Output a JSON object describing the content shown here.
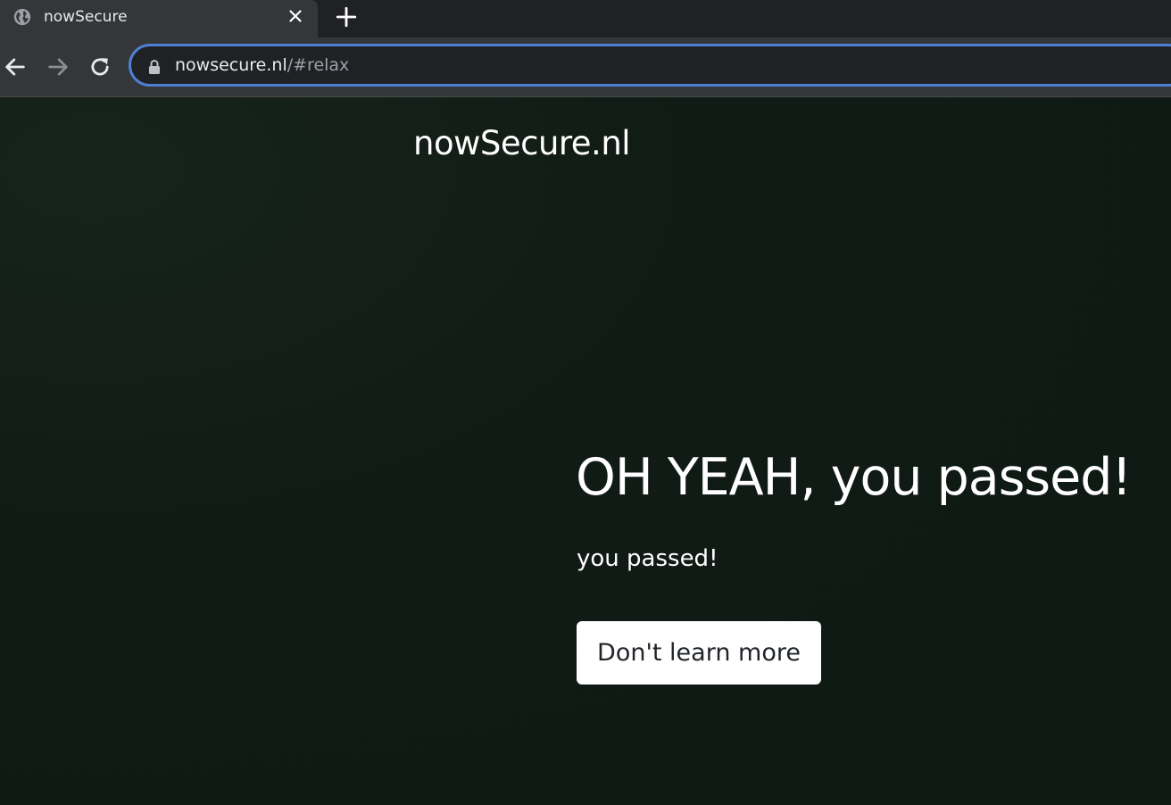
{
  "browser": {
    "tab": {
      "title": "nowSecure",
      "favicon": "globe-icon",
      "close_icon": "close-icon"
    },
    "new_tab_icon": "plus-icon",
    "nav": {
      "back_icon": "arrow-left-icon",
      "forward_icon": "arrow-right-icon",
      "reload_icon": "reload-icon"
    },
    "omnibox": {
      "lock_icon": "lock-icon",
      "host": "nowsecure.nl",
      "path": "/#relax",
      "focus_color": "#4f7fd4"
    }
  },
  "page": {
    "site_title": "nowSecure.nl",
    "headline": "OH YEAH, you passed!",
    "subtext": "you passed!",
    "button_label": "Don't learn more",
    "background_color": "#0f1a14"
  }
}
